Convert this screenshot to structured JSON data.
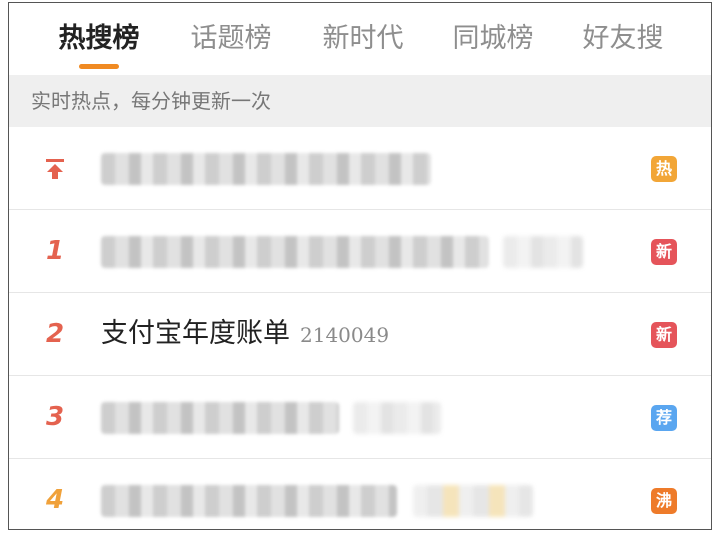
{
  "tabs": [
    {
      "label": "热搜榜",
      "active": true
    },
    {
      "label": "话题榜",
      "active": false
    },
    {
      "label": "新时代",
      "active": false
    },
    {
      "label": "同城榜",
      "active": false
    },
    {
      "label": "好友搜",
      "active": false
    }
  ],
  "info_text": "实时热点，每分钟更新一次",
  "rows": [
    {
      "rank": "",
      "rank_icon": "pin-top-icon",
      "title": "",
      "count": "",
      "badge": "热",
      "badge_color": "#f2a637"
    },
    {
      "rank": "1",
      "title": "",
      "count": "",
      "badge": "新",
      "badge_color": "#e5545a"
    },
    {
      "rank": "2",
      "title": "支付宝年度账单",
      "count": "2140049",
      "badge": "新",
      "badge_color": "#e5545a"
    },
    {
      "rank": "3",
      "title": "",
      "count": "",
      "badge": "荐",
      "badge_color": "#5aa6f0"
    },
    {
      "rank": "4",
      "title": "",
      "count": "",
      "badge": "沸",
      "badge_color": "#ee7b2a"
    }
  ],
  "colors": {
    "accent": "#f08a22",
    "rank_red": "#e4624f",
    "rank_orange": "#f0a13a"
  }
}
